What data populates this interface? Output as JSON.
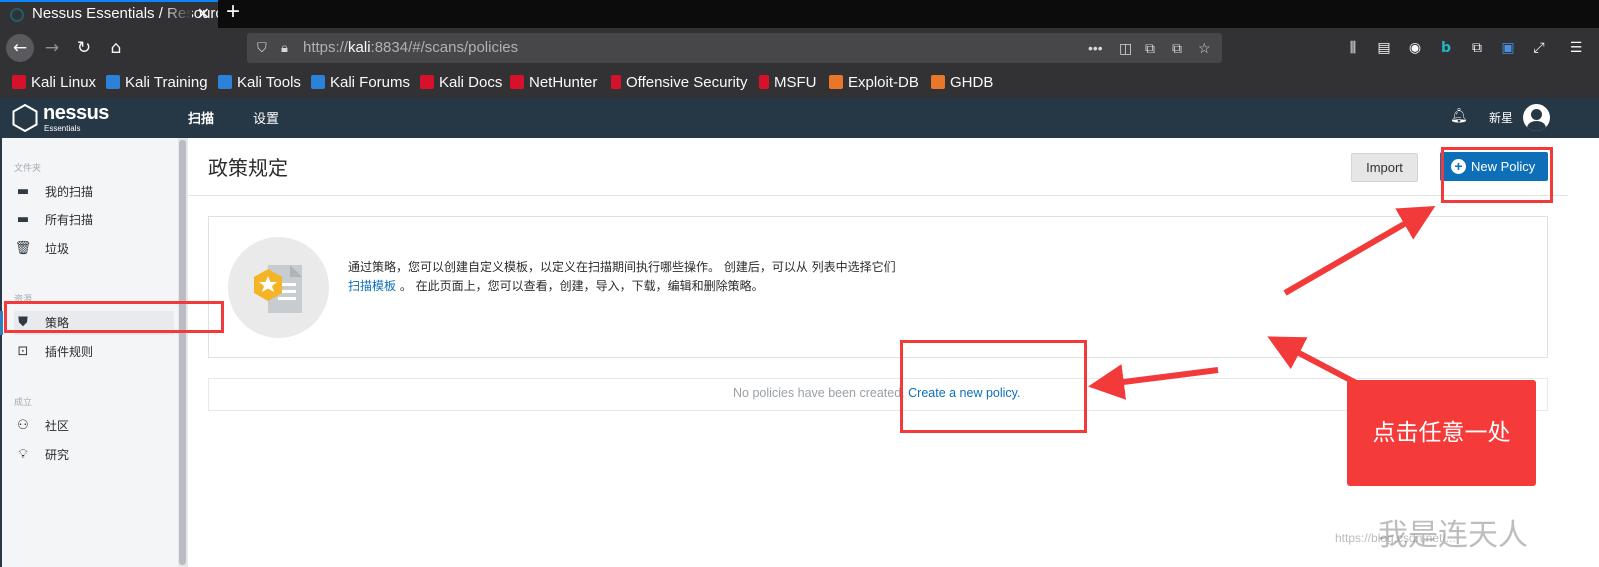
{
  "browser": {
    "tab_title": "Nessus Essentials / Resources / Policies",
    "url_prefix": "https://",
    "url_host": "kali",
    "url_rest": ":8834/#/scans/policies",
    "bookmarks": [
      {
        "label": "Kali Linux",
        "color": "#d6122b"
      },
      {
        "label": "Kali Training",
        "color": "#2b82d8"
      },
      {
        "label": "Kali Tools",
        "color": "#2b82d8"
      },
      {
        "label": "Kali Forums",
        "color": "#2b82d8"
      },
      {
        "label": "Kali Docs",
        "color": "#d6122b"
      },
      {
        "label": "NetHunter",
        "color": "#d6122b"
      },
      {
        "label": "Offensive Security",
        "color": "#d6122b"
      },
      {
        "label": "MSFU",
        "color": "#d6122b"
      },
      {
        "label": "Exploit-DB",
        "color": "#e8772a"
      },
      {
        "label": "GHDB",
        "color": "#e8772a"
      }
    ]
  },
  "header": {
    "logo": "nessus",
    "logo_sub": "Essentials",
    "nav_scans": "扫描",
    "nav_settings": "设置",
    "user_name": "新星"
  },
  "sidebar": {
    "folders_title": "文件夹",
    "folders": [
      "我的扫描",
      "所有扫描",
      "垃圾"
    ],
    "resources_title": "资源",
    "resources": [
      "策略",
      "插件规则"
    ],
    "community_title": "成立",
    "community": [
      "社区",
      "研究"
    ]
  },
  "main": {
    "title": "政策规定",
    "import_label": "Import",
    "new_policy_label": "New Policy",
    "info_line1": "通过策略，您可以创建自定义模板，以定义在扫描期间执行哪些操作。 创建后，可以从 列表中选择它们",
    "info_link": "扫描模板",
    "info_line2": " 。 在此页面上，您可以查看，创建，导入，下载，编辑和删除策略。",
    "empty_text": "No policies have been created. ",
    "empty_link": "Create a new policy",
    "empty_period": "."
  },
  "annotation": {
    "callout_text": "点击任意一处",
    "watermark": "我是连天人",
    "watermark_url": "https://blog.csdn.net/..."
  },
  "colors": {
    "accent": "#0c6fb7",
    "header_bg": "#263845",
    "annotation_red": "#f33a3a"
  }
}
